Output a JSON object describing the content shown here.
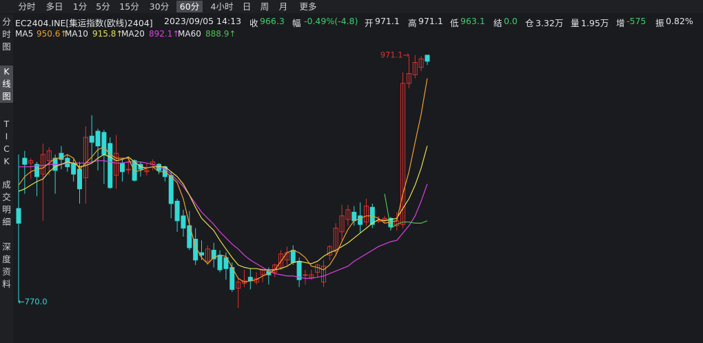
{
  "tabs": [
    "分时",
    "多日",
    "1分",
    "5分",
    "15分",
    "30分",
    "60分",
    "4小时",
    "日",
    "周",
    "月",
    "更多"
  ],
  "active_tab": "60分",
  "quote": {
    "symbol": "EC2404.INE[集运指数(欧线)2404]",
    "datetime": "2023/09/05 14:13",
    "close_label": "收",
    "close_value": "966.3",
    "change_label": "幅",
    "change_value": "-0.49%(-4.8)",
    "open_label": "开",
    "open_value": "971.1",
    "high_label": "高",
    "high_value": "971.1",
    "low_label": "低",
    "low_value": "963.1",
    "settle_label": "结",
    "settle_value": "0.0",
    "oi_label": "仓",
    "oi_value": "3.32万",
    "volume_label": "量",
    "volume_value": "1.95万",
    "oi_change_label": "增",
    "oi_change_value": "-575",
    "amplitude_label": "振",
    "amplitude_value": "0.82%"
  },
  "ma_legend": [
    {
      "name": "MA5",
      "value": "950.6↑",
      "color": "#f0a030"
    },
    {
      "name": "MA10",
      "value": "915.8↑",
      "color": "#e8e050"
    },
    {
      "name": "MA20",
      "value": "892.1↑",
      "color": "#e040e0"
    },
    {
      "name": "MA60",
      "value": "888.9↑",
      "color": "#50c050"
    }
  ],
  "sidebar": [
    "分时图",
    "K线图",
    "TICK",
    "成交明细",
    "深度资料"
  ],
  "sidebar_active": "K线图",
  "colors": {
    "up": "#e0302d",
    "down": "#33d9d4",
    "ma5": "#f0a030",
    "ma10": "#e8e050",
    "ma20": "#e040e0",
    "ma60": "#50c050",
    "background": "#1a1b1f"
  },
  "chart_data": {
    "type": "candlestick",
    "y_range": [
      760,
      985
    ],
    "annotations": [
      {
        "text": "971.1→",
        "price": 971.1,
        "color": "#e0302d"
      },
      {
        "text": "←770.0",
        "price": 770.0,
        "color": "#33d9d4"
      }
    ],
    "candles": [
      [
        846,
        834,
        890,
        770
      ],
      [
        887,
        882,
        893,
        858
      ],
      [
        883,
        885,
        887,
        870
      ],
      [
        882,
        872,
        884,
        856
      ],
      [
        874,
        890,
        899,
        836
      ],
      [
        885,
        893,
        896,
        873
      ],
      [
        887,
        877,
        890,
        858
      ],
      [
        891,
        886,
        897,
        878
      ],
      [
        887,
        880,
        890,
        876
      ],
      [
        883,
        874,
        886,
        868
      ],
      [
        878,
        862,
        884,
        850
      ],
      [
        871,
        904,
        913,
        850
      ],
      [
        905,
        900,
        922,
        884
      ],
      [
        909,
        897,
        911,
        877
      ],
      [
        908,
        890,
        910,
        866
      ],
      [
        899,
        863,
        904,
        862
      ],
      [
        873,
        891,
        906,
        862
      ],
      [
        883,
        876,
        886,
        868
      ],
      [
        878,
        878,
        888,
        874
      ],
      [
        885,
        869,
        886,
        868
      ],
      [
        882,
        878,
        884,
        872
      ],
      [
        876,
        877,
        883,
        873
      ],
      [
        882,
        884,
        886,
        877
      ],
      [
        882,
        877,
        883,
        874
      ],
      [
        880,
        872,
        881,
        868
      ],
      [
        873,
        850,
        876,
        838
      ],
      [
        852,
        836,
        854,
        827
      ],
      [
        840,
        830,
        845,
        823
      ],
      [
        832,
        814,
        844,
        812
      ],
      [
        821,
        804,
        830,
        800
      ],
      [
        810,
        808,
        820,
        804
      ],
      [
        803,
        813,
        816,
        800
      ],
      [
        812,
        805,
        818,
        798
      ],
      [
        808,
        796,
        812,
        794
      ],
      [
        806,
        797,
        810,
        788
      ],
      [
        798,
        780,
        802,
        778
      ],
      [
        781,
        786,
        790,
        765
      ],
      [
        785,
        787,
        796,
        782
      ],
      [
        790,
        787,
        797,
        780
      ],
      [
        786,
        789,
        794,
        784
      ],
      [
        792,
        796,
        797,
        786
      ],
      [
        795,
        792,
        798,
        784
      ],
      [
        794,
        800,
        801,
        790
      ],
      [
        798,
        809,
        812,
        796
      ],
      [
        804,
        810,
        815,
        800
      ],
      [
        812,
        802,
        816,
        800
      ],
      [
        803,
        788,
        806,
        782
      ],
      [
        792,
        792,
        796,
        784
      ],
      [
        790,
        792,
        796,
        788
      ],
      [
        794,
        800,
        801,
        790
      ],
      [
        786,
        799,
        804,
        782
      ],
      [
        808,
        815,
        816,
        804
      ],
      [
        811,
        830,
        834,
        808
      ],
      [
        827,
        840,
        849,
        820
      ],
      [
        837,
        845,
        849,
        832
      ],
      [
        843,
        836,
        848,
        832
      ],
      [
        840,
        833,
        851,
        826
      ],
      [
        835,
        848,
        854,
        832
      ],
      [
        847,
        833,
        850,
        830
      ],
      [
        836,
        836,
        840,
        834
      ],
      [
        837,
        838,
        840,
        834
      ],
      [
        838,
        831,
        839,
        828
      ],
      [
        832,
        836,
        843,
        828
      ],
      [
        833,
        948,
        957,
        830
      ],
      [
        948,
        956,
        970,
        944
      ],
      [
        955,
        965,
        971,
        952
      ],
      [
        961,
        968,
        970,
        958
      ],
      [
        971,
        966,
        971,
        963
      ]
    ],
    "ma5": [
      865,
      872,
      876,
      878,
      879,
      883,
      887,
      887,
      890,
      887,
      878,
      883,
      888,
      894,
      896,
      890,
      887,
      887,
      887,
      876,
      877,
      879,
      880,
      876,
      876,
      872,
      867,
      854,
      833,
      815,
      806,
      801,
      806,
      808,
      807,
      798,
      789,
      786,
      787,
      788,
      791,
      793,
      796,
      803,
      810,
      812,
      810,
      806,
      799,
      798,
      796,
      800,
      808,
      819,
      829,
      836,
      838,
      840,
      840,
      838,
      834,
      835,
      836,
      858,
      876,
      900,
      923,
      952
    ],
    "ma10": [
      860,
      862,
      865,
      868,
      870,
      876,
      880,
      882,
      884,
      883,
      880,
      881,
      883,
      887,
      890,
      888,
      885,
      886,
      888,
      884,
      880,
      879,
      880,
      880,
      880,
      876,
      872,
      866,
      857,
      847,
      838,
      833,
      828,
      820,
      813,
      806,
      800,
      798,
      797,
      797,
      796,
      796,
      796,
      797,
      799,
      802,
      803,
      802,
      801,
      803,
      807,
      810,
      812,
      815,
      818,
      822,
      826,
      830,
      834,
      837,
      836,
      837,
      838,
      846,
      854,
      865,
      879,
      897
    ],
    "ma20": [
      880,
      880,
      880,
      881,
      881,
      882,
      882,
      882,
      883,
      883,
      883,
      883,
      884,
      885,
      885,
      884,
      883,
      883,
      884,
      884,
      884,
      883,
      882,
      880,
      878,
      874,
      869,
      864,
      857,
      850,
      843,
      838,
      833,
      827,
      822,
      817,
      813,
      808,
      804,
      801,
      798,
      795,
      793,
      792,
      791,
      791,
      790,
      789,
      789,
      790,
      791,
      793,
      795,
      797,
      799,
      803,
      806,
      809,
      812,
      815,
      817,
      819,
      820,
      826,
      832,
      840,
      852,
      866
    ],
    "ma60": [
      858,
      830,
      833,
      835,
      835,
      834,
      834,
      836
    ]
  }
}
